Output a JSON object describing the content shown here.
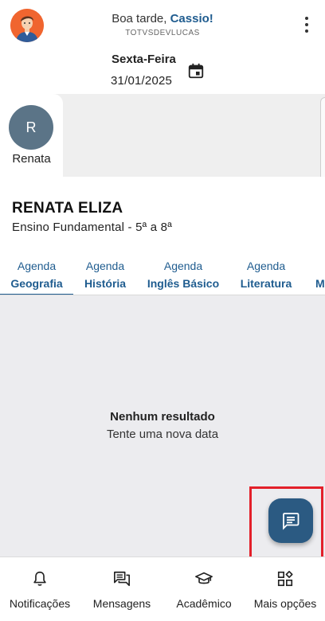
{
  "header": {
    "greeting_prefix": "Boa tarde,",
    "user_first_name": "Cassio!",
    "username": "TOTVSDEVLUCAS",
    "weekday": "Sexta-Feira",
    "date": "31/01/2025"
  },
  "students": [
    {
      "initial": "R",
      "name": "Renata"
    }
  ],
  "student_info": {
    "full_name": "RENATA ELIZA",
    "level": "Ensino Fundamental - 5ª a 8ª"
  },
  "tabs": [
    {
      "line1": "Agenda",
      "line2": "Geografia",
      "active": true
    },
    {
      "line1": "Agenda",
      "line2": "História",
      "active": false
    },
    {
      "line1": "Agenda",
      "line2": "Inglês Básico",
      "active": false
    },
    {
      "line1": "Agenda",
      "line2": "Literatura",
      "active": false
    },
    {
      "line1": "",
      "line2": "M",
      "active": false
    }
  ],
  "content": {
    "empty_title": "Nenhum resultado",
    "empty_subtitle": "Tente uma nova data"
  },
  "fab": {
    "icon": "message-icon"
  },
  "bottom_nav": [
    {
      "label": "Notificações",
      "icon": "bell-icon"
    },
    {
      "label": "Mensagens",
      "icon": "chat-icon"
    },
    {
      "label": "Acadêmico",
      "icon": "graduation-cap-icon"
    },
    {
      "label": "Mais opções",
      "icon": "apps-icon"
    }
  ],
  "colors": {
    "accent": "#1f5c8f",
    "fab": "#2b5a82",
    "highlight": "#e3202a",
    "student_avatar": "#5b7487",
    "content_bg": "#ececef"
  }
}
